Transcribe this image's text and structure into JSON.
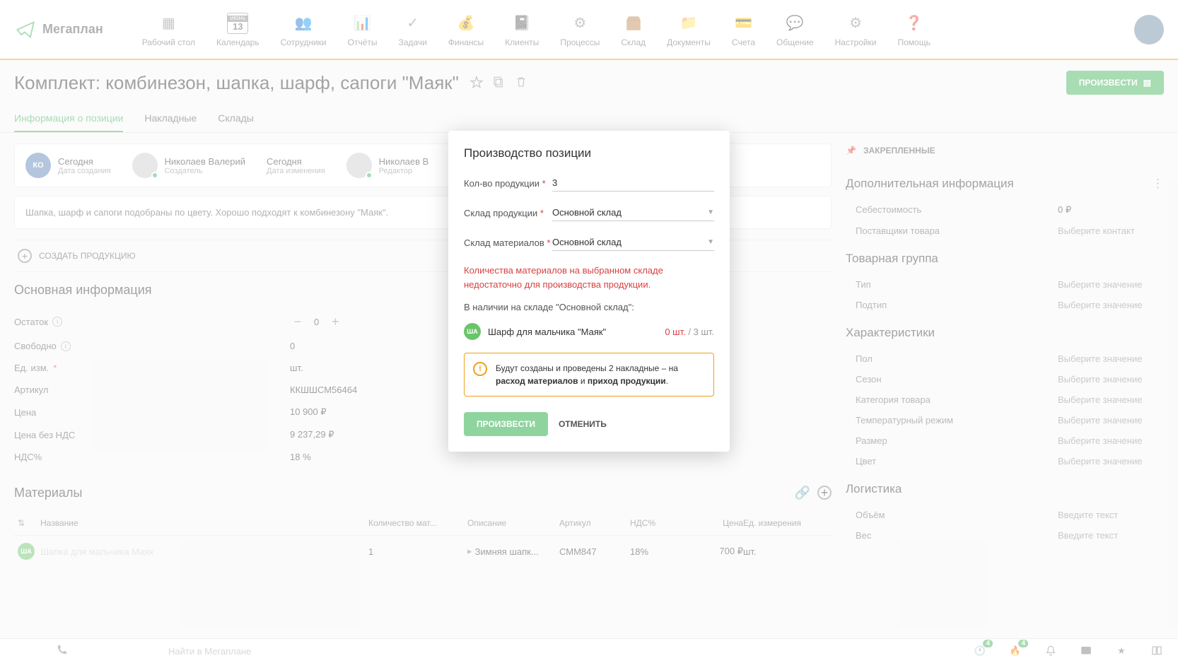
{
  "app": {
    "name": "Мегаплан"
  },
  "nav": [
    {
      "label": "Рабочий стол"
    },
    {
      "label": "Календарь"
    },
    {
      "label": "Сотрудники"
    },
    {
      "label": "Отчёты"
    },
    {
      "label": "Задачи"
    },
    {
      "label": "Финансы"
    },
    {
      "label": "Клиенты"
    },
    {
      "label": "Процессы"
    },
    {
      "label": "Склад"
    },
    {
      "label": "Документы"
    },
    {
      "label": "Счета"
    },
    {
      "label": "Общение"
    },
    {
      "label": "Настройки"
    },
    {
      "label": "Помощь"
    }
  ],
  "calendar_badge": "13",
  "calendar_month": "ИЮНЬ",
  "page": {
    "title": "Комплект: комбинезон, шапка, шарф, сапоги \"Маяк\"",
    "produce_btn": "ПРОИЗВЕСТИ"
  },
  "tabs": [
    {
      "label": "Информация о позиции",
      "active": true
    },
    {
      "label": "Накладные"
    },
    {
      "label": "Склады"
    }
  ],
  "meta": [
    {
      "top": "Сегодня",
      "bot": "Дата создания",
      "avatar": "КО"
    },
    {
      "top": "Николаев Валерий",
      "bot": "Создатель",
      "img": true
    },
    {
      "top": "Сегодня",
      "bot": "Дата изменения"
    },
    {
      "top": "Николаев В",
      "bot": "Редактор",
      "img": true
    }
  ],
  "description": "Шапка, шарф и сапоги подобраны по цвету. Хорошо подходят к комбинезону \"Маяк\".",
  "create_production": "СОЗДАТЬ ПРОДУКЦИЮ",
  "main_info": {
    "title": "Основная информация",
    "rows": [
      {
        "label": "Остаток",
        "info": true,
        "value": "0",
        "stepper": true
      },
      {
        "label": "Свободно",
        "info": true,
        "value": "0"
      },
      {
        "label": "Ед. изм.",
        "req": true,
        "value": "шт."
      },
      {
        "label": "Артикул",
        "value": "ККШШСМ56464"
      },
      {
        "label": "Цена",
        "value": "10 900 ₽"
      },
      {
        "label": "Цена без НДС",
        "value": "9 237,29 ₽"
      },
      {
        "label": "НДС%",
        "value": "18 %"
      }
    ]
  },
  "materials": {
    "title": "Материалы",
    "columns": [
      "Название",
      "Количество мат...",
      "Описание",
      "Артикул",
      "НДС%",
      "Цена",
      "Ед. измерения"
    ],
    "rows": [
      {
        "avatar": "ША",
        "name": "Шапка для мальчика Маяк",
        "qty": "1",
        "desc": "Зимняя шапк...",
        "sku": "СММ847",
        "vat": "18%",
        "price": "700 ₽",
        "unit": "шт."
      }
    ]
  },
  "sidebar": {
    "pinned": "ЗАКРЕПЛЕННЫЕ",
    "groups": [
      {
        "title": "Дополнительная информация",
        "dots": true,
        "rows": [
          {
            "label": "Себестоимость",
            "value": "0 ₽",
            "has": true
          },
          {
            "label": "Поставщики товара",
            "value": "Выберите контакт"
          }
        ]
      },
      {
        "title": "Товарная группа",
        "rows": [
          {
            "label": "Тип",
            "value": "Выберите значение"
          },
          {
            "label": "Подтип",
            "value": "Выберите значение"
          }
        ]
      },
      {
        "title": "Характеристики",
        "rows": [
          {
            "label": "Пол",
            "value": "Выберите значение"
          },
          {
            "label": "Сезон",
            "value": "Выберите значение"
          },
          {
            "label": "Категория товара",
            "value": "Выберите значение"
          },
          {
            "label": "Температурный режим",
            "value": "Выберите значение"
          },
          {
            "label": "Размер",
            "value": "Выберите значение"
          },
          {
            "label": "Цвет",
            "value": "Выберите значение"
          }
        ]
      },
      {
        "title": "Логистика",
        "rows": [
          {
            "label": "Объём",
            "value": "Введите текст"
          },
          {
            "label": "Вес",
            "value": "Введите текст"
          }
        ]
      }
    ]
  },
  "modal": {
    "title": "Производство позиции",
    "qty_label": "Кол-во продукции",
    "qty_value": "3",
    "prod_store_label": "Склад продукции",
    "prod_store_value": "Основной склад",
    "mat_store_label": "Склад материалов",
    "mat_store_value": "Основной склад",
    "error": "Количества материалов на выбранном складе недостаточно для производства продукции.",
    "avail_label": "В наличии на складе \"Основной склад\":",
    "avail_items": [
      {
        "avatar": "ША",
        "name": "Шарф для мальчика \"Маяк\"",
        "have": "0 шт.",
        "need": "3 шт."
      }
    ],
    "note_prefix": "Будут созданы и проведены 2 накладные – на ",
    "note_bold1": "расход материалов",
    "note_mid": " и ",
    "note_bold2": "приход продукции",
    "note_suffix": ".",
    "produce_btn": "ПРОИЗВЕСТИ",
    "cancel_btn": "ОТМЕНИТЬ"
  },
  "bottom": {
    "search": "Найти в Мегаплане",
    "badges": {
      "clock": "4",
      "fire": "4"
    }
  }
}
